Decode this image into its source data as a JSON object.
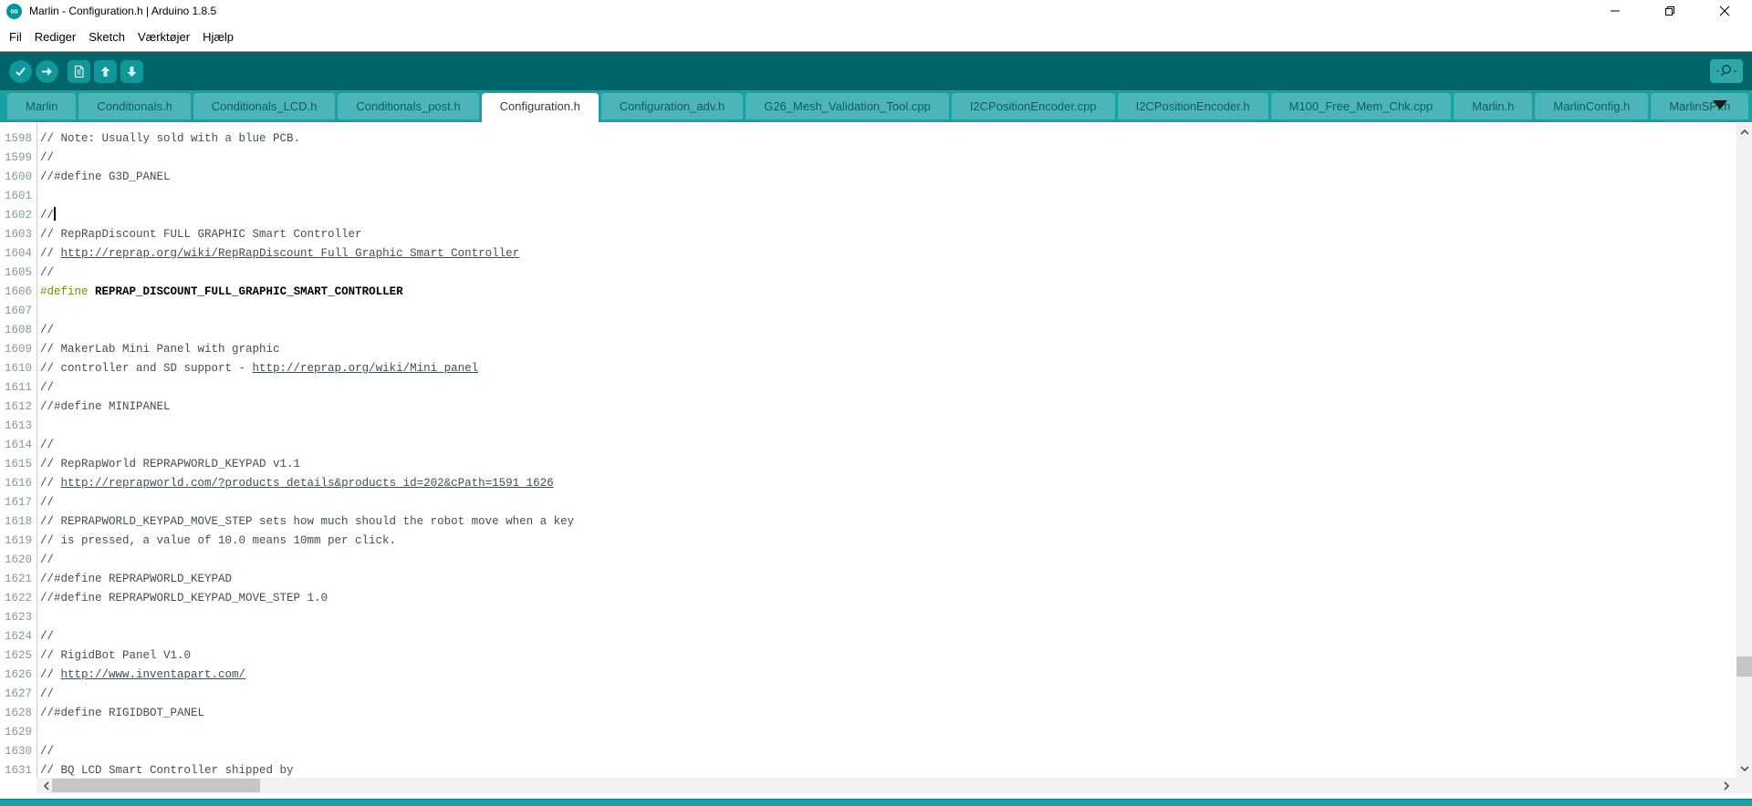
{
  "window": {
    "title": "Marlin - Configuration.h | Arduino 1.8.5",
    "app_icon": "arduino-infinity-logo",
    "icon_glyph": "∞",
    "controls": [
      {
        "name": "minimize",
        "icon": "minimize-icon"
      },
      {
        "name": "restore",
        "icon": "restore-icon"
      },
      {
        "name": "close",
        "icon": "close-icon"
      }
    ]
  },
  "menu": {
    "items": [
      "Fil",
      "Rediger",
      "Sketch",
      "Værktøjer",
      "Hjælp"
    ]
  },
  "toolbar": {
    "buttons": [
      {
        "name": "verify",
        "icon": "check-icon",
        "shape": "circle"
      },
      {
        "name": "upload",
        "icon": "arrow-right-icon",
        "shape": "circle"
      },
      {
        "name": "new-sketch",
        "icon": "document-icon",
        "shape": "square"
      },
      {
        "name": "open",
        "icon": "arrow-up-icon",
        "shape": "square"
      },
      {
        "name": "save",
        "icon": "arrow-down-icon",
        "shape": "square"
      }
    ],
    "serial_monitor": {
      "name": "serial-monitor",
      "icon": "magnifier-icon"
    }
  },
  "tabs": {
    "items": [
      {
        "label": "Marlin",
        "active": false
      },
      {
        "label": "Conditionals.h",
        "active": false
      },
      {
        "label": "Conditionals_LCD.h",
        "active": false
      },
      {
        "label": "Conditionals_post.h",
        "active": false
      },
      {
        "label": "Configuration.h",
        "active": true
      },
      {
        "label": "Configuration_adv.h",
        "active": false
      },
      {
        "label": "G26_Mesh_Validation_Tool.cpp",
        "active": false
      },
      {
        "label": "I2CPositionEncoder.cpp",
        "active": false
      },
      {
        "label": "I2CPositionEncoder.h",
        "active": false
      },
      {
        "label": "M100_Free_Mem_Chk.cpp",
        "active": false
      },
      {
        "label": "Marlin.h",
        "active": false
      },
      {
        "label": "MarlinConfig.h",
        "active": false
      },
      {
        "label": "MarlinSPI.h",
        "active": false,
        "partially_visible": true
      }
    ],
    "overflow_icon": "chevron-down-icon"
  },
  "editor": {
    "first_line": 1598,
    "last_line": 1631,
    "lines": [
      {
        "n": 1598,
        "segs": [
          {
            "t": "// Note: Usually sold with a blue PCB.",
            "s": "comment"
          }
        ]
      },
      {
        "n": 1599,
        "segs": [
          {
            "t": "//",
            "s": "comment"
          }
        ]
      },
      {
        "n": 1600,
        "segs": [
          {
            "t": "//#define G3D_PANEL",
            "s": "comment"
          }
        ]
      },
      {
        "n": 1601,
        "segs": []
      },
      {
        "n": 1602,
        "segs": [
          {
            "t": "//",
            "s": "comment"
          }
        ],
        "caret": true
      },
      {
        "n": 1603,
        "segs": [
          {
            "t": "// RepRapDiscount FULL GRAPHIC Smart Controller",
            "s": "comment"
          }
        ]
      },
      {
        "n": 1604,
        "segs": [
          {
            "t": "// ",
            "s": "comment"
          },
          {
            "t": "http://reprap.org/wiki/RepRapDiscount_Full_Graphic_Smart_Controller",
            "s": "link"
          }
        ]
      },
      {
        "n": 1605,
        "segs": [
          {
            "t": "//",
            "s": "comment"
          }
        ]
      },
      {
        "n": 1606,
        "segs": [
          {
            "t": "#define",
            "s": "keyword"
          },
          {
            "t": " ",
            "s": "plain"
          },
          {
            "t": "REPRAP_DISCOUNT_FULL_GRAPHIC_SMART_CONTROLLER",
            "s": "bold"
          }
        ]
      },
      {
        "n": 1607,
        "segs": []
      },
      {
        "n": 1608,
        "segs": [
          {
            "t": "//",
            "s": "comment"
          }
        ]
      },
      {
        "n": 1609,
        "segs": [
          {
            "t": "// MakerLab Mini Panel with graphic",
            "s": "comment"
          }
        ]
      },
      {
        "n": 1610,
        "segs": [
          {
            "t": "// controller and SD support - ",
            "s": "comment"
          },
          {
            "t": "http://reprap.org/wiki/Mini_panel",
            "s": "link"
          }
        ]
      },
      {
        "n": 1611,
        "segs": [
          {
            "t": "//",
            "s": "comment"
          }
        ]
      },
      {
        "n": 1612,
        "segs": [
          {
            "t": "//#define MINIPANEL",
            "s": "comment"
          }
        ]
      },
      {
        "n": 1613,
        "segs": []
      },
      {
        "n": 1614,
        "segs": [
          {
            "t": "//",
            "s": "comment"
          }
        ]
      },
      {
        "n": 1615,
        "segs": [
          {
            "t": "// RepRapWorld REPRAPWORLD_KEYPAD v1.1",
            "s": "comment"
          }
        ]
      },
      {
        "n": 1616,
        "segs": [
          {
            "t": "// ",
            "s": "comment"
          },
          {
            "t": "http://reprapworld.com/?products_details&products_id=202&cPath=1591_1626",
            "s": "link"
          }
        ]
      },
      {
        "n": 1617,
        "segs": [
          {
            "t": "//",
            "s": "comment"
          }
        ]
      },
      {
        "n": 1618,
        "segs": [
          {
            "t": "// REPRAPWORLD_KEYPAD_MOVE_STEP sets how much should the robot move when a key",
            "s": "comment"
          }
        ]
      },
      {
        "n": 1619,
        "segs": [
          {
            "t": "// is pressed, a value of 10.0 means 10mm per click.",
            "s": "comment"
          }
        ]
      },
      {
        "n": 1620,
        "segs": [
          {
            "t": "//",
            "s": "comment"
          }
        ]
      },
      {
        "n": 1621,
        "segs": [
          {
            "t": "//#define REPRAPWORLD_KEYPAD",
            "s": "comment"
          }
        ]
      },
      {
        "n": 1622,
        "segs": [
          {
            "t": "//#define REPRAPWORLD_KEYPAD_MOVE_STEP 1.0",
            "s": "comment"
          }
        ]
      },
      {
        "n": 1623,
        "segs": []
      },
      {
        "n": 1624,
        "segs": [
          {
            "t": "//",
            "s": "comment"
          }
        ]
      },
      {
        "n": 1625,
        "segs": [
          {
            "t": "// RigidBot Panel V1.0",
            "s": "comment"
          }
        ]
      },
      {
        "n": 1626,
        "segs": [
          {
            "t": "// ",
            "s": "comment"
          },
          {
            "t": "http://www.inventapart.com/",
            "s": "link"
          }
        ]
      },
      {
        "n": 1627,
        "segs": [
          {
            "t": "//",
            "s": "comment"
          }
        ]
      },
      {
        "n": 1628,
        "segs": [
          {
            "t": "//#define RIGIDBOT_PANEL",
            "s": "comment"
          }
        ]
      },
      {
        "n": 1629,
        "segs": []
      },
      {
        "n": 1630,
        "segs": [
          {
            "t": "//",
            "s": "comment"
          }
        ]
      },
      {
        "n": 1631,
        "segs": [
          {
            "t": "// BQ LCD Smart Controller shipped by",
            "s": "comment"
          }
        ]
      }
    ]
  },
  "colors": {
    "toolbar_bg": "#006468",
    "toolbar_button_bg": "#0f989c",
    "tabbar_bg": "#17a1a5",
    "inactive_tab_bg": "#4cb5b9",
    "inactive_tab_text": "#0d5f62",
    "active_tab_bg": "#ffffff",
    "status_strip": "#17a1a5",
    "comment": "#434f54",
    "keyword": "#728e00",
    "line_number": "#86989a",
    "arduino_logo": "#00979c"
  }
}
